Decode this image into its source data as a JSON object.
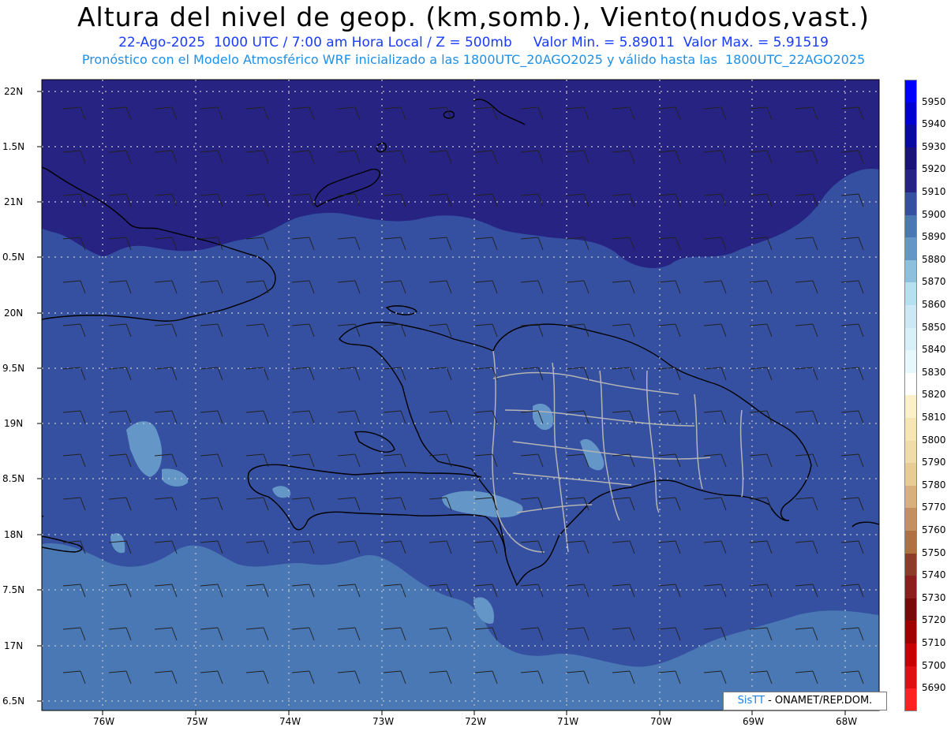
{
  "header": {
    "title": "Altura del nivel de geop. (km,somb.), Viento(nudos,vast.)",
    "line1": "22-Ago-2025  1000 UTC / 7:00 am Hora Local / Z = 500mb     Valor Min. = 5.89011  Valor Max. = 5.91519",
    "line2": "Pronóstico con el Modelo Atmosférico WRF inicializado a las 1800UTC_20AGO2025 y válido hasta las  1800UTC_22AGO2025"
  },
  "lat_labels": [
    "22N",
    "1.5N",
    "21N",
    "0.5N",
    "20N",
    "9.5N",
    "19N",
    "8.5N",
    "18N",
    "7.5N",
    "17N",
    "6.5N"
  ],
  "lon_labels": [
    "76W",
    "75W",
    "74W",
    "73W",
    "72W",
    "71W",
    "70W",
    "69W",
    "68W"
  ],
  "colorbar": {
    "levels": [
      "5950",
      "5940",
      "5930",
      "5920",
      "5910",
      "5900",
      "5890",
      "5880",
      "5870",
      "5860",
      "5850",
      "5840",
      "5830",
      "5820",
      "5810",
      "5800",
      "5790",
      "5780",
      "5770",
      "5760",
      "5750",
      "5740",
      "5730",
      "5720",
      "5710",
      "5700",
      "5690"
    ],
    "colors": [
      "#0000ff",
      "#0000d2",
      "#0a0aa0",
      "#1a1478",
      "#262383",
      "#3550a0",
      "#4a78b4",
      "#6496c8",
      "#8cc0dc",
      "#b4e0f0",
      "#cce8f4",
      "#d8f0f8",
      "#e6f8fc",
      "#ffffff",
      "#fbf0c8",
      "#f5e6b4",
      "#f0dca8",
      "#e8cc96",
      "#d8b07c",
      "#c49060",
      "#b07040",
      "#8c3c28",
      "#8c1e1e",
      "#780a0a",
      "#a00000",
      "#c80000",
      "#e01010",
      "#ff2020"
    ]
  },
  "fill_colors": {
    "band_5910": "#262383",
    "band_5900": "#3550a0",
    "band_5890": "#4a78b4",
    "band_5880": "#6496c8"
  },
  "credit": {
    "logo": "SisTT",
    "text": " - ONAMET/REP.DOM."
  }
}
